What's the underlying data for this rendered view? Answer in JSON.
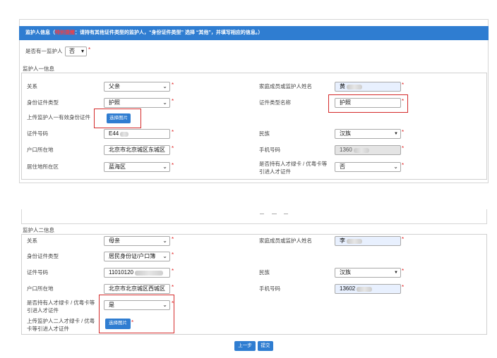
{
  "header": {
    "title_open": "监护人信息（",
    "alert": "特别提醒",
    "notice": "：请持有其他证件类型的监护人，“身份证件类型” 选择 “其他”，并填写相应的信息。）"
  },
  "required_mark": "*",
  "has_guardian": {
    "label": "是否有一监护人",
    "value": "否"
  },
  "guardian1": {
    "legend": "监护人一信息",
    "relation_label": "关系",
    "relation": "父亲",
    "name_label": "家庭成员或监护人姓名",
    "name": "黄",
    "id_type_label": "身份证件类型",
    "id_type": "护照",
    "id_type_name_label": "证件类型名称",
    "id_type_name": "护照",
    "upload_label": "上传监护人一有效身份证件",
    "upload_button": "选择图片",
    "id_number_label": "证件号码",
    "id_number": "E44",
    "ethnicity_label": "民族",
    "ethnicity": "汉族",
    "hukou_label": "户口所在地",
    "hukou": "北京市北京城区东城区",
    "phone_label": "手机号码",
    "phone": "1360",
    "residence_label": "居住地所在区",
    "residence": "蓝海区",
    "talent_card_label_1": "是否持有人才绿卡 / 优粤卡等",
    "talent_card_label_2": "引进人才证件",
    "talent_card": "否"
  },
  "guardian2": {
    "legend": "监护人二信息",
    "relation_label": "关系",
    "relation": "母亲",
    "name_label": "家庭成员或监护人姓名",
    "name": "李",
    "id_type_label": "身份证件类型",
    "id_type": "居民身份证/户口簿",
    "id_number_label": "证件号码",
    "id_number": "11010120",
    "ethnicity_label": "民族",
    "ethnicity": "汉族",
    "hukou_label": "户口所在地",
    "hukou": "北京市北京城区西城区",
    "phone_label": "手机号码",
    "phone": "13602",
    "talent_card_label_1": "是否持有人才绿卡 / 优粤卡等",
    "talent_card_label_2": "引进人才证件",
    "talent_card": "是",
    "upload_label_1": "上传监护人二人才绿卡 / 优粤",
    "upload_label_2": "卡等引进人才证件",
    "upload_button": "选择图片"
  },
  "buttons": {
    "prev": "上一步",
    "submit": "提交"
  },
  "colors": {
    "header_bg": "#2f7dd1",
    "button_bg": "#2f7dd1",
    "alert": "#ff3b3b",
    "required": "#e02020",
    "highlight_box": "#d42a2a",
    "name_field_bg": "#e8f0fe",
    "readonly_bg": "#e4e4e4"
  }
}
